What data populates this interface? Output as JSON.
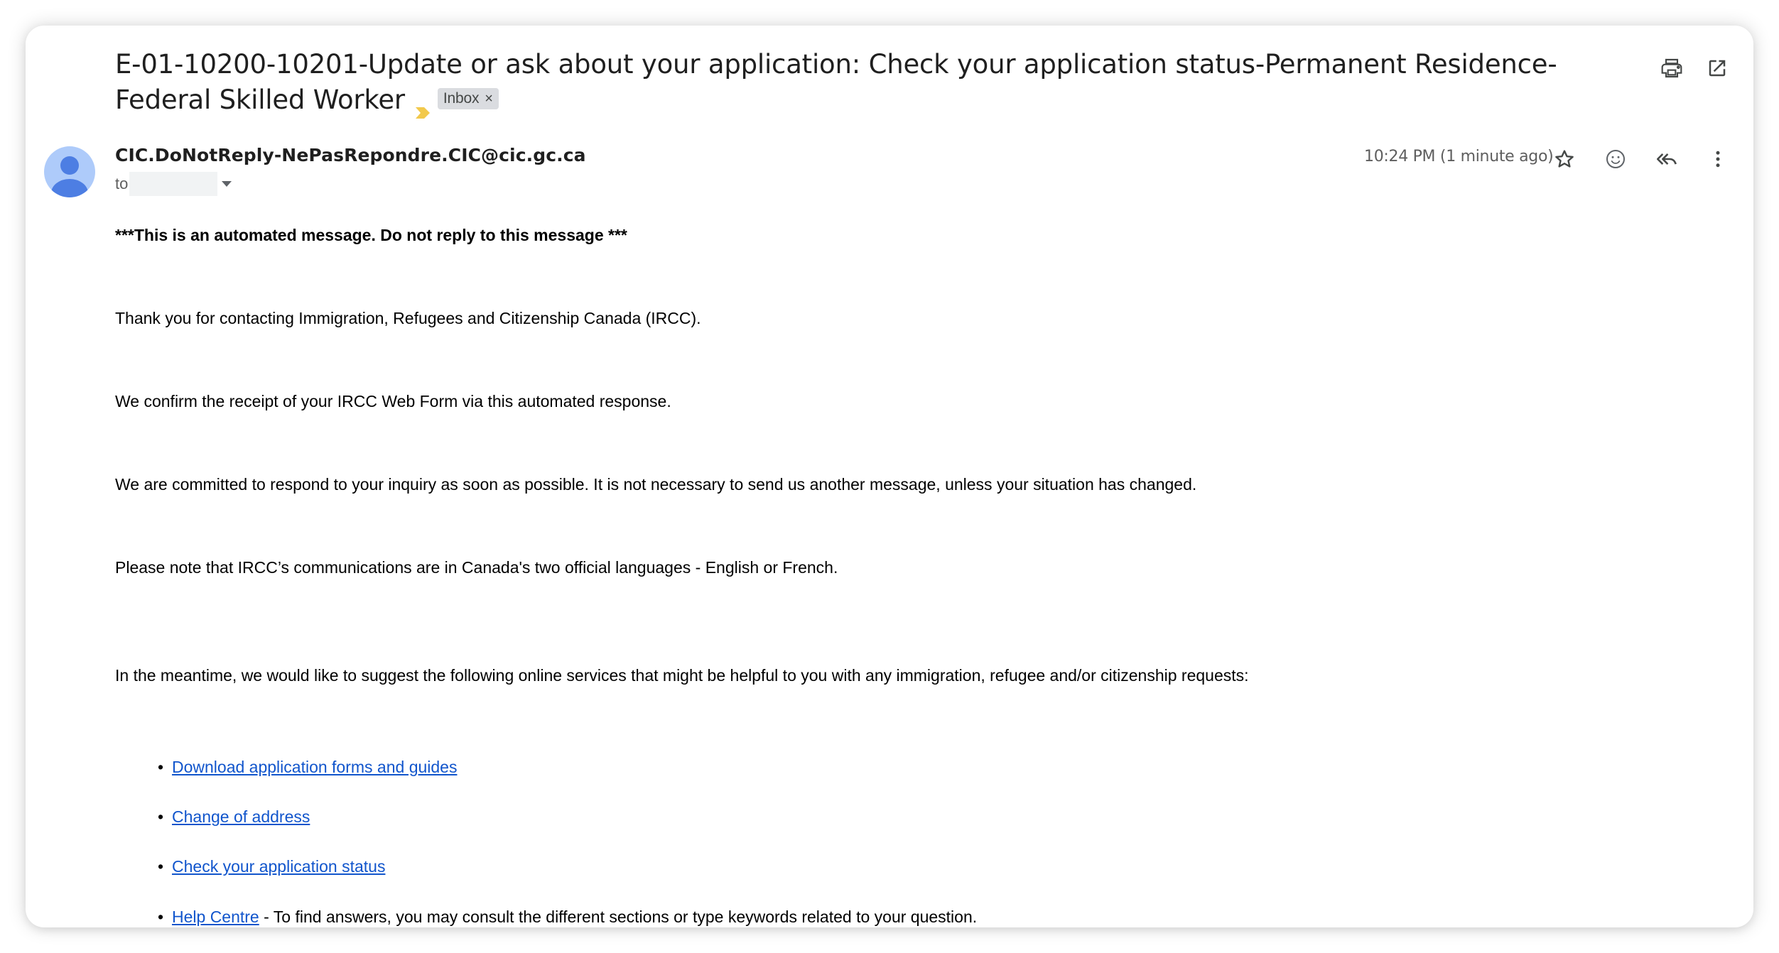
{
  "email": {
    "subject": "E-01-10200-10201-Update or ask about your application: Check your application status-Permanent Residence-Federal Skilled Worker",
    "label": "Inbox",
    "label_remove": "×",
    "sender": "CIC.DoNotReply-NePasRepondre.CIC@cic.gc.ca",
    "to_prefix": "to",
    "timestamp": "10:24 PM (1 minute ago)"
  },
  "icons": {
    "print": "print-icon",
    "open_new_window": "open-in-new-window-icon",
    "star": "star-icon",
    "emoji": "emoji-reaction-icon",
    "reply_all": "reply-all-icon",
    "more": "more-vertical-icon",
    "importance": "importance-marker-icon",
    "avatar": "default-avatar-icon"
  },
  "colors": {
    "link": "#1155cc",
    "importance": "#f2c94c",
    "avatar_bg": "#aecbfa",
    "avatar_fg": "#4d7ee3"
  },
  "body": {
    "p1": "***This is an automated message. Do not reply to this message ***",
    "p2": "Thank you for contacting Immigration, Refugees and Citizenship Canada (IRCC).",
    "p3": "We confirm the receipt of your IRCC Web Form via this automated response.",
    "p4": "We are committed to respond to your inquiry as soon as possible. It is not necessary to send us another message, unless your situation has changed.",
    "p5": "Please note that IRCC’s communications are in Canada's two official languages - English or French.",
    "p6": "In the meantime, we would like to suggest the following online services that might be helpful to you with any immigration, refugee and/or citizenship requests:",
    "links": [
      {
        "text": "Download application forms and guides",
        "after": ""
      },
      {
        "text": "Change of address",
        "after": ""
      },
      {
        "text": "Check your application status",
        "after": ""
      },
      {
        "text": "Help Centre",
        "after": " - To find answers, you may consult the different sections or type keywords related to your question."
      }
    ],
    "bullet": "•"
  }
}
